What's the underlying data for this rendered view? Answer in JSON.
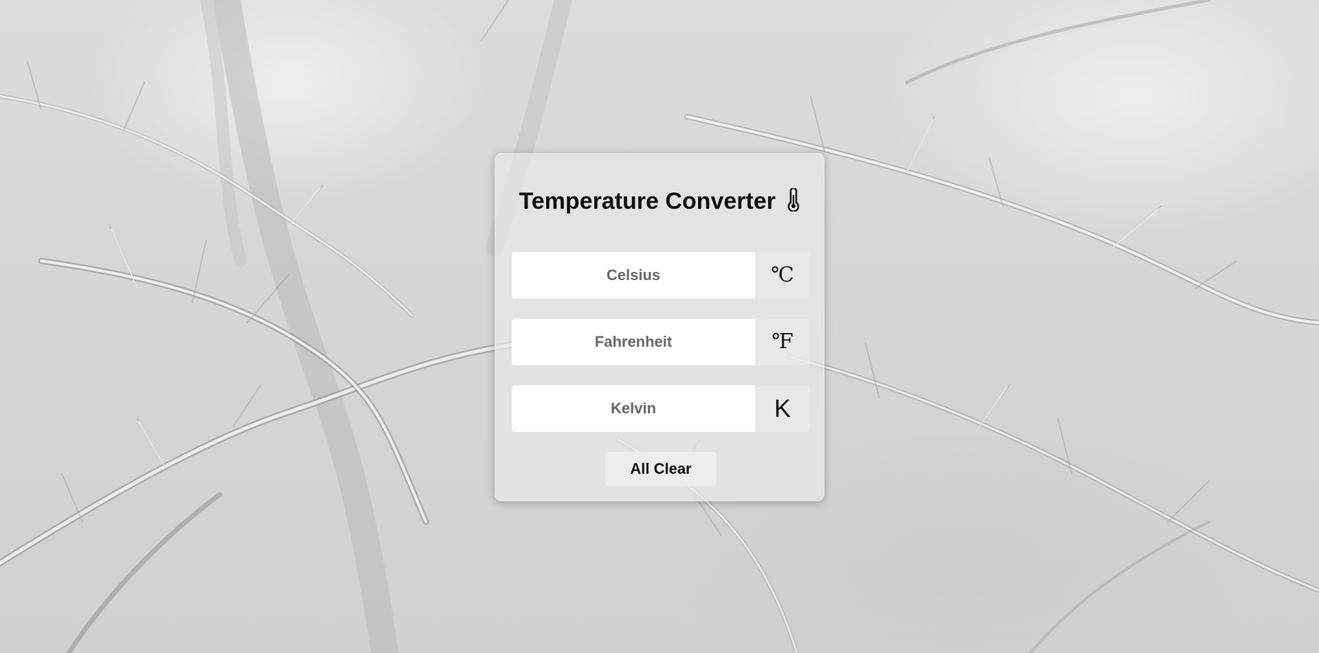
{
  "app": {
    "title": "Temperature Converter",
    "title_icon": "thermometer-icon"
  },
  "fields": [
    {
      "name": "celsius",
      "placeholder": "Celsius",
      "value": "",
      "unit": "℃"
    },
    {
      "name": "fahrenheit",
      "placeholder": "Fahrenheit",
      "value": "",
      "unit": "℉"
    },
    {
      "name": "kelvin",
      "placeholder": "Kelvin",
      "value": "",
      "unit": "K"
    }
  ],
  "actions": {
    "clear_label": "All Clear"
  },
  "theme": {
    "card_background": "#e8e8ea",
    "input_background": "#ffffff",
    "button_background": "#ededed",
    "text_color": "#111111",
    "placeholder_color": "#666666",
    "background_image": "snowy-tree-branches"
  }
}
